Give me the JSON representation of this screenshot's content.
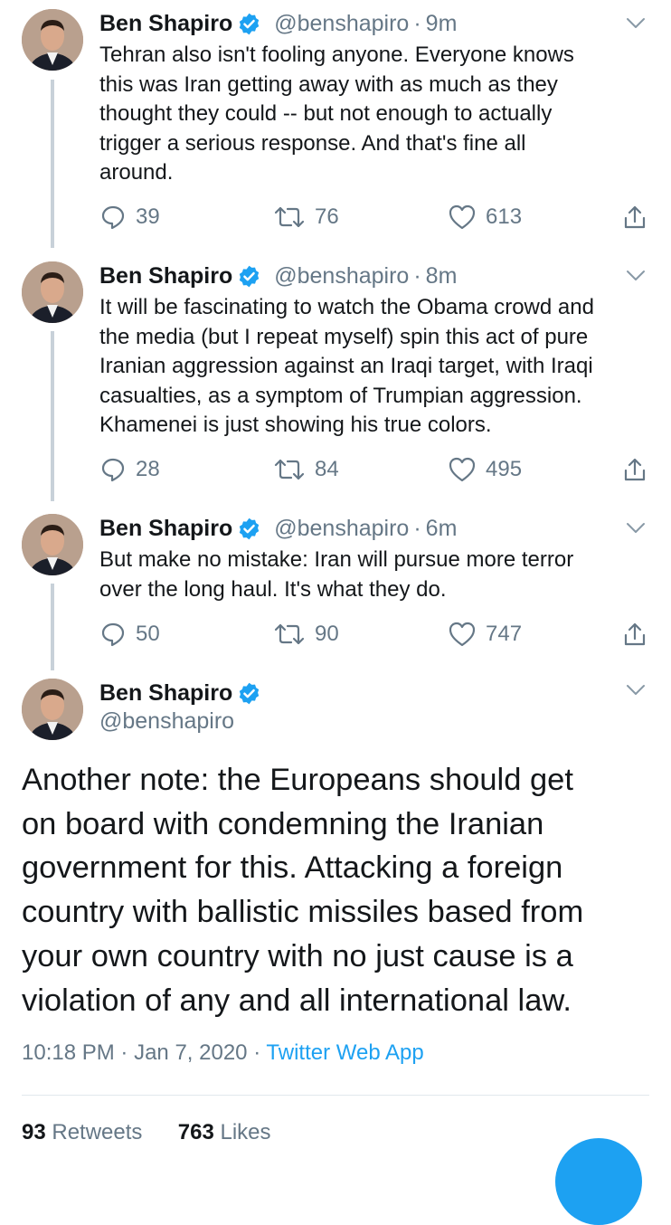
{
  "colors": {
    "accent": "#1da1f2",
    "text_primary": "#14171a",
    "text_secondary": "#657786",
    "thread_line": "#c8d1d9"
  },
  "tweets": [
    {
      "name": "Ben Shapiro",
      "handle": "@benshapiro",
      "sep": "·",
      "time": "9m",
      "text": "Tehran also isn't fooling anyone. Everyone knows\nthis was Iran getting away with as much as they\nthought they could -- but not enough to actually\ntrigger a serious response. And that's fine all\naround.",
      "replies": "39",
      "retweets": "76",
      "likes": "613"
    },
    {
      "name": "Ben Shapiro",
      "handle": "@benshapiro",
      "sep": "·",
      "time": "8m",
      "text": "It will be fascinating to watch the Obama crowd and\nthe media (but I repeat myself) spin this act of pure\nIranian aggression against an Iraqi target, with Iraqi\ncasualties, as a symptom of Trumpian aggression.\nKhamenei is just showing his true colors.",
      "replies": "28",
      "retweets": "84",
      "likes": "495"
    },
    {
      "name": "Ben Shapiro",
      "handle": "@benshapiro",
      "sep": "·",
      "time": "6m",
      "text": "But make no mistake: Iran will pursue more terror\nover the long haul. It's what they do.",
      "replies": "50",
      "retweets": "90",
      "likes": "747"
    }
  ],
  "main_tweet": {
    "name": "Ben Shapiro",
    "handle": "@benshapiro",
    "text": "Another note: the Europeans should get\non board with condemning the Iranian\ngovernment for this. Attacking a foreign\ncountry with ballistic missiles based from\nyour own country with no just cause is a\nviolation of any and all international law.",
    "time": "10:18 PM",
    "date": "Jan 7, 2020",
    "sep": "·",
    "source": "Twitter Web App",
    "retweet_count": "93",
    "retweet_label": "Retweets",
    "like_count": "763",
    "like_label": "Likes"
  }
}
